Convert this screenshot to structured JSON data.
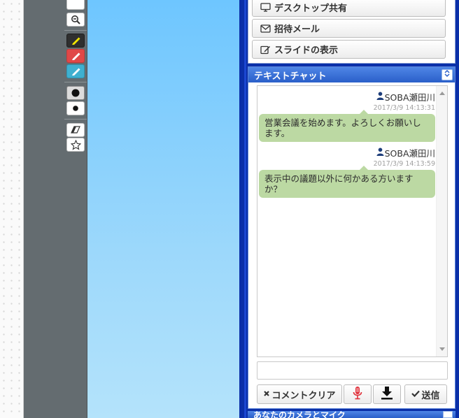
{
  "menu": {
    "desktop_share": "デスクトップ共有",
    "invite_mail": "招待メール",
    "slide_show": "スライドの表示"
  },
  "chat": {
    "title": "テキストチャット",
    "messages": [
      {
        "user": "SOBA瀬田川",
        "time": "2017/3/9 14:13:31",
        "text": "営業会議を始めます。よろしくお願いします。"
      },
      {
        "user": "SOBA瀬田川",
        "time": "2017/3/9 14:13:59",
        "text": "表示中の議題以外に何かある方いますか？"
      }
    ],
    "input_value": "",
    "comment_clear_label": "コメントクリア",
    "send_label": "送信"
  },
  "next_panel": {
    "title": "あなたのカメラとマイク"
  },
  "colors": {
    "frame": "#0a2fa8",
    "header": "#2a5fc9",
    "bubble": "#bcd9a3",
    "toolbar": "#646c70",
    "canvas": "#6ec6ff",
    "mic": "#e0303a"
  },
  "icons": [
    "zoom-out-icon",
    "highlighter-yellow-icon",
    "pen-red-icon",
    "pen-blue-icon",
    "dot-large-icon",
    "dot-small-icon",
    "eraser-icon",
    "star-icon",
    "monitor-icon",
    "envelope-icon",
    "edit-icon",
    "user-icon",
    "times-icon",
    "microphone-icon",
    "download-icon",
    "check-icon",
    "collapse-toggle-icon"
  ]
}
